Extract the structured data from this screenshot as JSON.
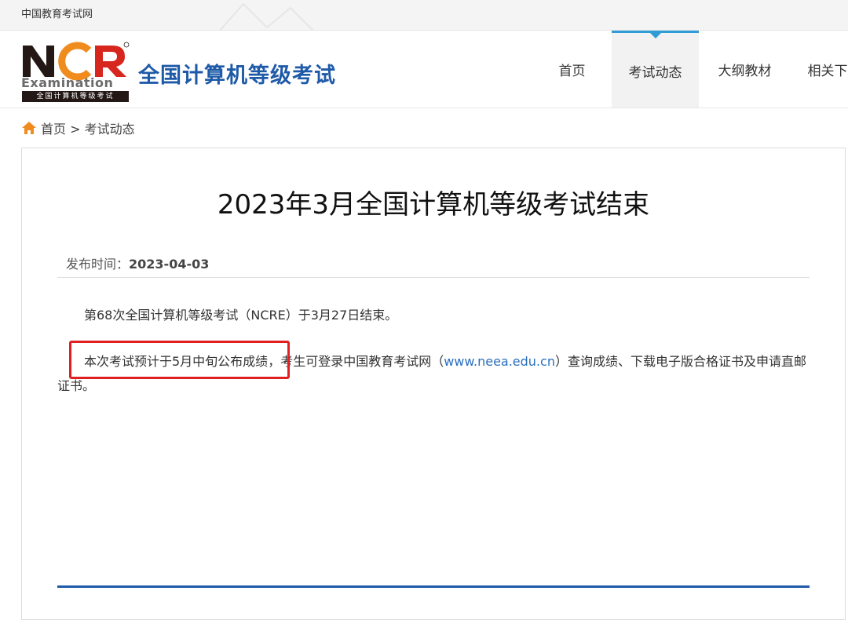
{
  "topbar": {
    "site_name": "中国教育考试网"
  },
  "header": {
    "logo_letters": "NCR",
    "logo_examination": "Examination",
    "logo_subtitle": "全国计算机等级考试",
    "site_title": "全国计算机等级考试"
  },
  "nav": {
    "items": [
      {
        "label": "首页"
      },
      {
        "label": "考试动态"
      },
      {
        "label": "大纲教材"
      },
      {
        "label": "相关下载"
      }
    ],
    "active_index": 1
  },
  "breadcrumb": {
    "home": "首页",
    "separator": ">",
    "current": "考试动态"
  },
  "article": {
    "title": "2023年3月全国计算机等级考试结束",
    "publish_label": "发布时间：",
    "publish_date": "2023-04-03",
    "para1": "第68次全国计算机等级考试（NCRE）于3月27日结束。",
    "para2_highlight": "本次考试预计于5月中旬公布成绩",
    "para2_mid": "，考生可登录中国教育考试网（",
    "para2_link": "www.neea.edu.cn",
    "para2_end": "）查询成绩、下载电子版合格证书及申请直邮证书。"
  },
  "colors": {
    "brand_blue": "#1e5aa8",
    "nav_accent": "#2f9bd7",
    "highlight_red": "#e02020",
    "link_blue": "#2a6fbd"
  }
}
